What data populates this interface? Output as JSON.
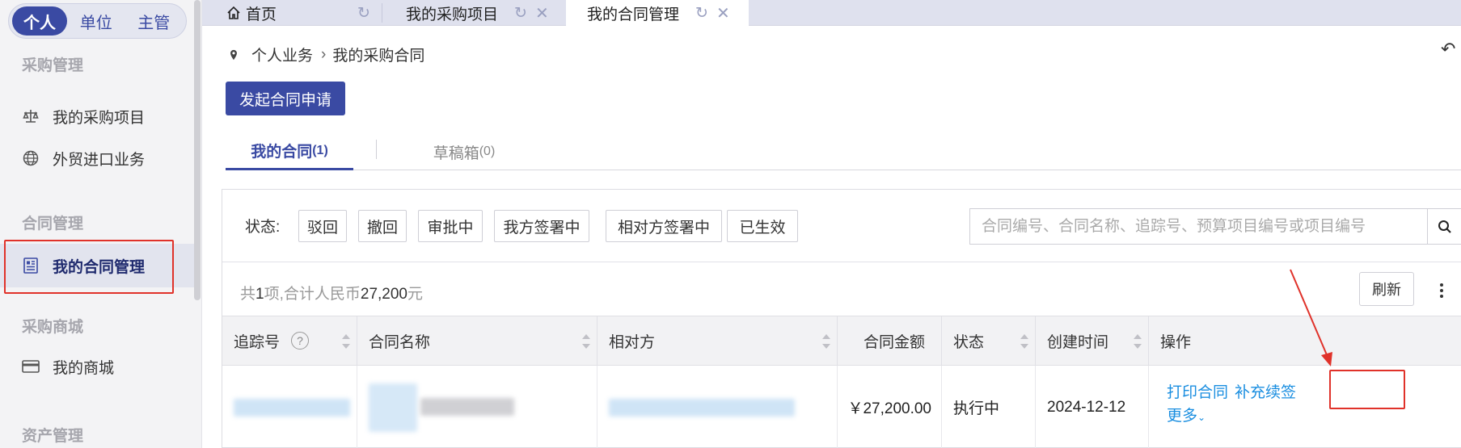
{
  "sidebar": {
    "roles": [
      "个人",
      "单位",
      "主管"
    ],
    "sections": {
      "procurement": "采购管理",
      "contract": "合同管理",
      "mall": "采购商城",
      "asset": "资产管理"
    },
    "items": {
      "my_projects": "我的采购项目",
      "foreign_trade": "外贸进口业务",
      "my_contracts": "我的合同管理",
      "my_mall": "我的商城"
    }
  },
  "tabs": [
    {
      "label": "首页"
    },
    {
      "label": "我的采购项目"
    },
    {
      "label": "我的合同管理"
    }
  ],
  "breadcrumb": {
    "root": "个人业务",
    "current": "我的采购合同"
  },
  "toolbar": {
    "new_contract": "发起合同申请"
  },
  "subtabs": {
    "mine_label": "我的合同",
    "mine_count": "(1)",
    "drafts_label": "草稿箱",
    "drafts_count": "(0)"
  },
  "filter": {
    "label": "状态:",
    "statuses": [
      "驳回",
      "撤回",
      "审批中",
      "我方签署中",
      "相对方签署中",
      "已生效"
    ],
    "search_placeholder": "合同编号、合同名称、追踪号、预算项目编号或项目编号"
  },
  "summary": {
    "prefix": "共",
    "count": "1",
    "mid": "项,合计人民币",
    "amount": "27,200",
    "suffix": "元"
  },
  "refresh_label": "刷新",
  "table": {
    "headers": {
      "tracking": "追踪号",
      "name": "合同名称",
      "counterparty": "相对方",
      "amount": "合同金额",
      "status": "状态",
      "created": "创建时间",
      "actions": "操作"
    },
    "row": {
      "amount": "￥27,200.00",
      "status": "执行中",
      "created": "2024-12-12",
      "print": "打印合同",
      "supplement": "补充续签",
      "more": "更多"
    }
  },
  "colors": {
    "primary": "#3a4aa3",
    "link": "#1a8ee0",
    "highlight": "#e0322a"
  }
}
